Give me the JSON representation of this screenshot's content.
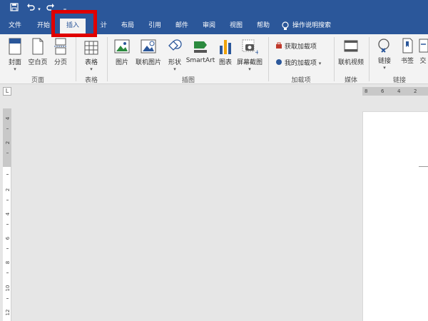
{
  "quick_access": {
    "save_icon": "save-icon",
    "undo_icon": "undo-icon",
    "redo_icon": "redo-icon",
    "more_icon": "customize-qat-icon"
  },
  "tabs": [
    {
      "label": "文件"
    },
    {
      "label": "开始"
    },
    {
      "label": "插入"
    },
    {
      "label": "设计"
    },
    {
      "label": "布局"
    },
    {
      "label": "引用"
    },
    {
      "label": "邮件"
    },
    {
      "label": "审阅"
    },
    {
      "label": "视图"
    },
    {
      "label": "帮助"
    },
    {
      "label": "操作说明搜索"
    }
  ],
  "active_tab": "插入",
  "ribbon": {
    "pages_group": {
      "label": "页面",
      "cover": "封面",
      "blank": "空白页",
      "break": "分页"
    },
    "table_group": {
      "label": "表格",
      "table": "表格"
    },
    "illustrations_group": {
      "label": "插图",
      "picture": "图片",
      "online_picture": "联机图片",
      "shapes": "形状",
      "smartart": "SmartArt",
      "chart": "图表",
      "screenshot": "屏幕截图"
    },
    "addins_group": {
      "label": "加载项",
      "get_addins": "获取加载项",
      "my_addins": "我的加载项"
    },
    "media_group": {
      "label": "媒体",
      "online_video": "联机视频"
    },
    "links_group": {
      "label": "链接",
      "link": "链接",
      "bookmark": "书签",
      "crossref": "交"
    }
  },
  "ruler": {
    "corner_glyph": "L",
    "h_numbers": [
      "8",
      "6",
      "4",
      "2"
    ],
    "v_numbers": [
      "4",
      "2",
      "2",
      "4",
      "6",
      "8",
      "10",
      "12"
    ]
  },
  "colors": {
    "brand": "#2b579a",
    "highlight": "#e00000",
    "ribbon_bg": "#f3f3f3",
    "canvas_bg": "#e6e6e6"
  }
}
